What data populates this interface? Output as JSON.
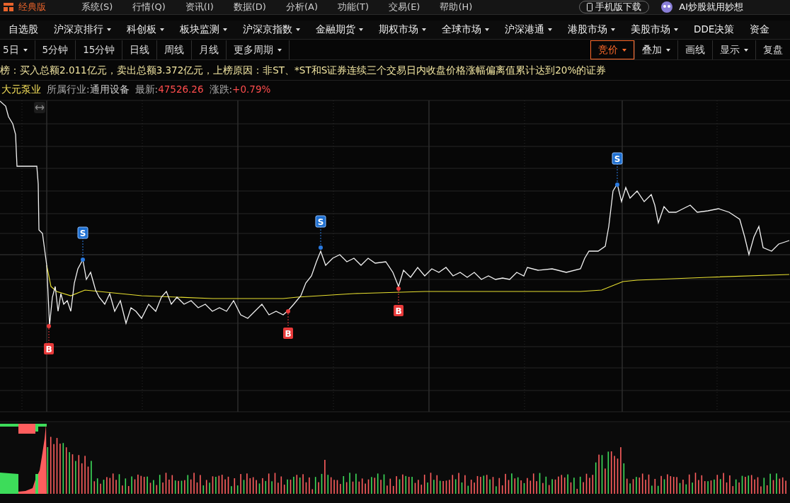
{
  "top_bar": {
    "edition": "经典版",
    "menu": [
      "系统(S)",
      "行情(Q)",
      "资讯(I)",
      "数据(D)",
      "分析(A)",
      "功能(T)",
      "交易(E)",
      "帮助(H)"
    ],
    "mobile_download": "手机版下载",
    "ai_promo": "AI炒股就用妙想"
  },
  "market_nav": [
    {
      "label": "自选股",
      "has_menu": false
    },
    {
      "label": "沪深京排行",
      "has_menu": true
    },
    {
      "label": "科创板",
      "has_menu": true
    },
    {
      "label": "板块监测",
      "has_menu": true
    },
    {
      "label": "沪深京指数",
      "has_menu": true
    },
    {
      "label": "金融期货",
      "has_menu": true
    },
    {
      "label": "期权市场",
      "has_menu": true
    },
    {
      "label": "全球市场",
      "has_menu": true
    },
    {
      "label": "沪深港通",
      "has_menu": true
    },
    {
      "label": "港股市场",
      "has_menu": true
    },
    {
      "label": "美股市场",
      "has_menu": true
    },
    {
      "label": "DDE决策",
      "has_menu": false
    },
    {
      "label": "资金",
      "has_menu": false
    }
  ],
  "period_toolbar": {
    "periods": [
      {
        "label": "5日",
        "has_menu": true,
        "selected": false
      },
      {
        "label": "5分钟",
        "has_menu": false,
        "selected": false
      },
      {
        "label": "15分钟",
        "has_menu": false,
        "selected": false
      },
      {
        "label": "日线",
        "has_menu": false,
        "selected": false
      },
      {
        "label": "周线",
        "has_menu": false,
        "selected": false
      },
      {
        "label": "月线",
        "has_menu": false,
        "selected": false
      },
      {
        "label": "更多周期",
        "has_menu": true,
        "selected": false
      }
    ],
    "tools": [
      {
        "label": "竞价",
        "has_menu": true,
        "selected": true
      },
      {
        "label": "叠加",
        "has_menu": true,
        "selected": false
      },
      {
        "label": "画线",
        "has_menu": false,
        "selected": false
      },
      {
        "label": "显示",
        "has_menu": true,
        "selected": false
      },
      {
        "label": "复盘",
        "has_menu": false,
        "selected": false
      }
    ]
  },
  "notice": "榜：买入总额2.011亿元，卖出总额3.372亿元，上榜原因：非ST、*ST和S证券连续三个交易日内收盘价格涨幅偏离值累计达到20%的证券",
  "stock": {
    "name": "大元泵业",
    "industry_label": "所属行业:",
    "industry": "通用设备",
    "latest_label": "最新:",
    "latest": "47526.26",
    "change_label": "涨跌:",
    "change": "+0.79%"
  },
  "chart": {
    "markers": [
      {
        "kind": "buy",
        "label": "B"
      },
      {
        "kind": "sell",
        "label": "S"
      },
      {
        "kind": "buy",
        "label": "B"
      },
      {
        "kind": "sell",
        "label": "S"
      },
      {
        "kind": "buy",
        "label": "B"
      },
      {
        "kind": "sell",
        "label": "S"
      }
    ]
  }
}
